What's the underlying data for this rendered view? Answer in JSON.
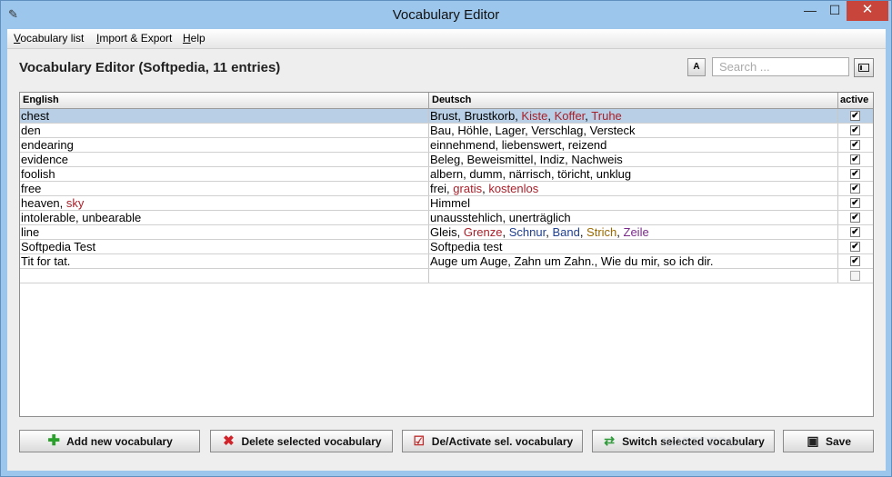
{
  "window": {
    "title": "Vocabulary Editor"
  },
  "menu": [
    {
      "label": "Vocabulary list",
      "u": "V",
      "rest": "ocabulary list"
    },
    {
      "label": "Import & Export",
      "u": "I",
      "rest": "mport & Export"
    },
    {
      "label": "Help",
      "u": "H",
      "rest": "elp"
    }
  ],
  "heading": "Vocabulary Editor (Softpedia, 11 entries)",
  "toolbar": {
    "font_button_label": "A",
    "search_placeholder": "Search ..."
  },
  "table": {
    "columns": [
      "English",
      "Deutsch",
      "active"
    ],
    "rows": [
      {
        "selected": true,
        "english": [
          [
            "chest",
            ""
          ]
        ],
        "deutsch": [
          [
            "Brust, Brustkorb, ",
            ""
          ],
          [
            "Kiste",
            "#a8202a"
          ],
          [
            ", ",
            ""
          ],
          [
            "Koffer",
            "#a8202a"
          ],
          [
            ", ",
            ""
          ],
          [
            "Truhe",
            "#a8202a"
          ]
        ],
        "active": true
      },
      {
        "english": [
          [
            "den",
            ""
          ]
        ],
        "deutsch": [
          [
            "Bau, Höhle, Lager, Verschlag, Versteck",
            ""
          ]
        ],
        "active": true
      },
      {
        "english": [
          [
            "endearing",
            ""
          ]
        ],
        "deutsch": [
          [
            "einnehmend, liebenswert, reizend",
            ""
          ]
        ],
        "active": true
      },
      {
        "english": [
          [
            "evidence",
            ""
          ]
        ],
        "deutsch": [
          [
            "Beleg, Beweismittel, Indiz, Nachweis",
            ""
          ]
        ],
        "active": true
      },
      {
        "english": [
          [
            "foolish",
            ""
          ]
        ],
        "deutsch": [
          [
            "albern, dumm, närrisch, töricht, unklug",
            ""
          ]
        ],
        "active": true
      },
      {
        "english": [
          [
            "free",
            ""
          ]
        ],
        "deutsch": [
          [
            "frei, ",
            ""
          ],
          [
            "gratis",
            "#a8202a"
          ],
          [
            ", ",
            ""
          ],
          [
            "kostenlos",
            "#a8202a"
          ]
        ],
        "active": true
      },
      {
        "english": [
          [
            "heaven, ",
            ""
          ],
          [
            "sky",
            "#a8202a"
          ]
        ],
        "deutsch": [
          [
            "Himmel",
            ""
          ]
        ],
        "active": true
      },
      {
        "english": [
          [
            "intolerable, unbearable",
            ""
          ]
        ],
        "deutsch": [
          [
            "unausstehlich, unerträglich",
            ""
          ]
        ],
        "active": true
      },
      {
        "english": [
          [
            "line",
            ""
          ]
        ],
        "deutsch": [
          [
            "Gleis, ",
            ""
          ],
          [
            "Grenze",
            "#a8202a"
          ],
          [
            ", ",
            ""
          ],
          [
            "Schnur",
            "#1f3f8f"
          ],
          [
            ", ",
            ""
          ],
          [
            "Band",
            "#1f3f8f"
          ],
          [
            ", ",
            ""
          ],
          [
            "Strich",
            "#9a6a00"
          ],
          [
            ", ",
            ""
          ],
          [
            "Zeile",
            "#7a2a8a"
          ]
        ],
        "active": true
      },
      {
        "english": [
          [
            "Softpedia Test",
            ""
          ]
        ],
        "deutsch": [
          [
            "Softpedia test",
            ""
          ]
        ],
        "active": true
      },
      {
        "english": [
          [
            "Tit for tat.",
            ""
          ]
        ],
        "deutsch": [
          [
            "Auge um Auge, Zahn um Zahn., Wie du mir, so ich dir.",
            ""
          ]
        ],
        "active": true
      },
      {
        "english": [],
        "deutsch": [],
        "active": false
      }
    ]
  },
  "buttons": {
    "add": {
      "label": "Add new vocabulary",
      "icon": "plus-icon"
    },
    "delete": {
      "label": "Delete selected vocabulary",
      "icon": "red-x-icon"
    },
    "toggle": {
      "label": "De/Activate sel. vocabulary",
      "icon": "checklist-icon"
    },
    "switch": {
      "label": "Switch selected vocabulary",
      "icon": "swap-arrows-icon"
    },
    "save": {
      "label": "Save",
      "icon": "floppy-disk-icon"
    }
  },
  "watermark": "SOFTPEDIA",
  "colors": {
    "accent_red": "#a8202a",
    "accent_blue": "#1f3f8f",
    "accent_gold": "#9a6a00",
    "accent_purple": "#7a2a8a",
    "selection": "#b8cfe5",
    "close_button": "#c7453a"
  }
}
